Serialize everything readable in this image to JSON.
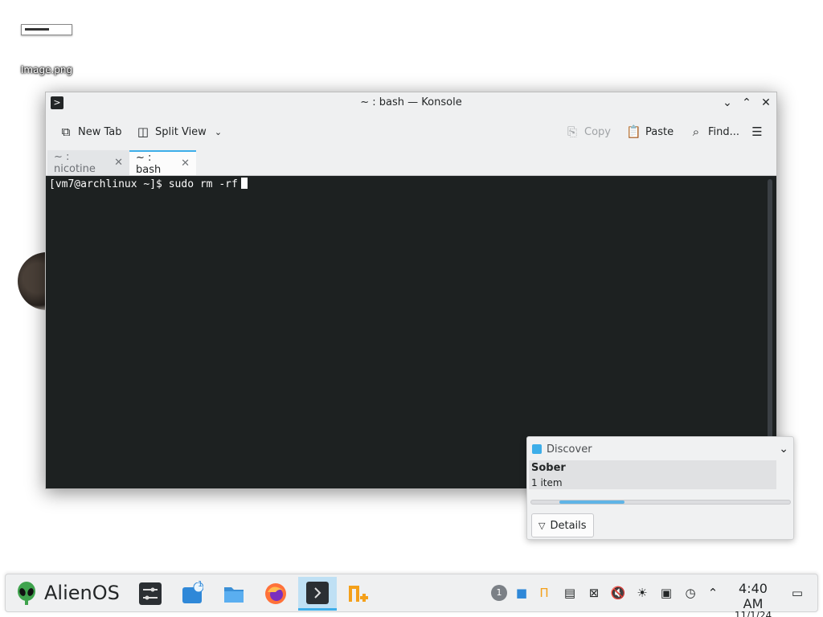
{
  "desktop": {
    "icon_label": "Image.png"
  },
  "window": {
    "title": "~ : bash — Konsole",
    "controls": {
      "minimize": "⌄",
      "maximize": "⌃",
      "close": "✕"
    },
    "toolbar": {
      "new_tab": "New Tab",
      "split_view": "Split View",
      "copy": "Copy",
      "paste": "Paste",
      "find": "Find...",
      "menu_icon": "hamburger-menu-icon"
    },
    "tabs": [
      {
        "label": "~ : nicotine",
        "active": false
      },
      {
        "label": "~ : bash",
        "active": true
      }
    ],
    "terminal": {
      "prompt": "[vm7@archlinux ~]$ ",
      "command": "sudo rm -rf"
    }
  },
  "notification": {
    "app": "Discover",
    "title": "Sober",
    "subtitle": "1 item",
    "progress": 0.25,
    "details_label": "Details"
  },
  "taskbar": {
    "launcher_label": "AlienOS",
    "tasks": [
      "settings-mixer",
      "discover-store",
      "file-manager",
      "firefox",
      "konsole",
      "nplus"
    ],
    "store_badge": "1",
    "tray_badge": "1",
    "clock": {
      "time": "4:40 AM",
      "date": "11/1/24"
    }
  },
  "colors": {
    "accent": "#3daee9",
    "terminal_bg": "#1d2121",
    "window_bg": "#eff0f1"
  }
}
